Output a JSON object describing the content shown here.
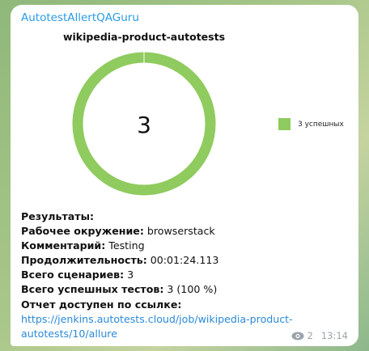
{
  "sender": "AutotestAllertQAGuru",
  "chart": {
    "title": "wikipedia-product-autotests",
    "center_value": "3",
    "legend": "3 успешных",
    "color": "#8fcb5e",
    "passed": 3,
    "total": 3
  },
  "lines": [
    {
      "label": "Результаты:",
      "value": ""
    },
    {
      "label": "Рабочее окружение:",
      "value": " browserstack"
    },
    {
      "label": "Комментарий:",
      "value": " Testing"
    },
    {
      "label": "Продолжительность:",
      "value": " 00:01:24.113"
    },
    {
      "label": "Всего сценариев:",
      "value": " 3"
    },
    {
      "label": "Всего успешных тестов:",
      "value": " 3 (100 %)"
    },
    {
      "label": "Отчет доступен по ссылке:",
      "value": ""
    }
  ],
  "link": "https://jenkins.autotests.cloud/job/wikipedia-product-autotests/10/allure",
  "views": "2",
  "time": "13:14"
}
